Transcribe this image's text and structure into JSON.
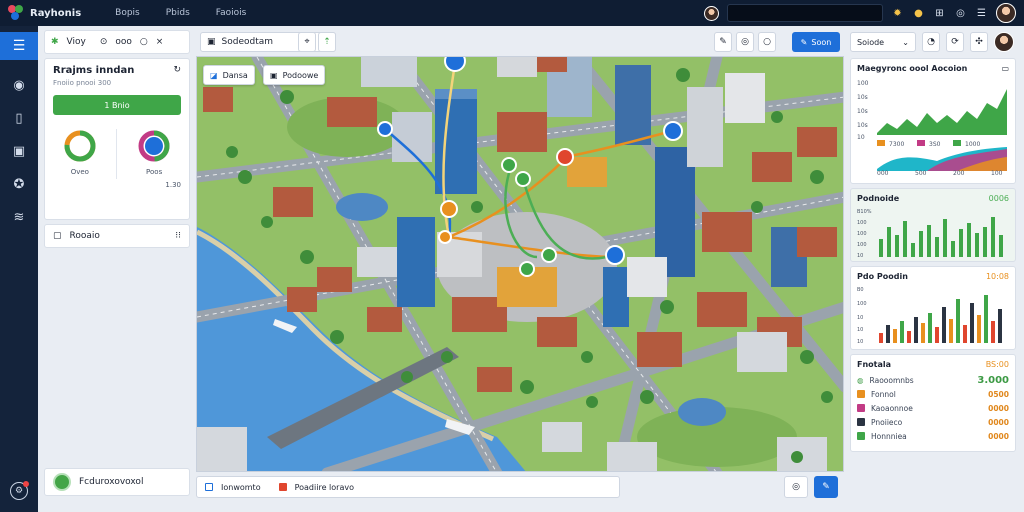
{
  "app": {
    "title": "Rayhonis"
  },
  "topnav": [
    "Bopis",
    "Pbids",
    "Faoiois"
  ],
  "colors": {
    "navy": "#0f1d33",
    "accent_blue": "#1e6fd9",
    "green": "#3fa648",
    "orange": "#e8901f",
    "water": "#4f97d9",
    "grass": "#93c067"
  },
  "left": {
    "view_label": "Vioy",
    "sort_label": "ooo",
    "project": {
      "title": "Rrajms inndan",
      "subtitle": "Fnoiio pnooi 300",
      "button": "1 Bnio"
    },
    "donut_1_label": "Oveo",
    "donut_2_label": "Poos",
    "donut_2_value": "1.30",
    "row_label": "Rooaio",
    "bottom_label": "Fcduroxovoxol"
  },
  "map": {
    "search_value": "Sodeodtam",
    "chip_1": "Dansa",
    "chip_2": "Podoowe",
    "action_button": "Soon",
    "bottom_status_1": "Ionwomto",
    "bottom_status_2": "Poadiire loravo"
  },
  "right": {
    "select_label": "Soiode",
    "chart_1": {
      "title": "Maegyronc oool Aocoion",
      "y_labels": [
        "100",
        "10s",
        "10s",
        "10s",
        "10"
      ],
      "x_labels": [
        "000",
        "500",
        "200",
        "100"
      ],
      "legend_1": "7300",
      "legend_2": "3S0",
      "legend_3": "1000"
    },
    "chart_2": {
      "title": "Podnoide",
      "value": "0006",
      "y_labels": [
        "B10%",
        "100",
        "100",
        "100",
        "10"
      ]
    },
    "chart_3": {
      "title": "Pdo Poodin",
      "value": "10:08",
      "y_labels": [
        "B0",
        "100",
        "10",
        "10",
        "10"
      ]
    },
    "budget": {
      "title": "Fnotala",
      "value": "BS:00",
      "rows": [
        {
          "label": "Raooomnbs",
          "amount": "3.000",
          "color": "#3c9a44"
        },
        {
          "label": "Fonnol",
          "amount": "0500",
          "color": "#e8901f"
        },
        {
          "label": "Kaoaonnoe",
          "amount": "0000",
          "color": "#c23b85"
        },
        {
          "label": "Pnoiieco",
          "amount": "0000",
          "color": "#2b3442"
        },
        {
          "label": "Honnniea",
          "amount": "0000",
          "color": "#3fa648"
        }
      ]
    }
  }
}
